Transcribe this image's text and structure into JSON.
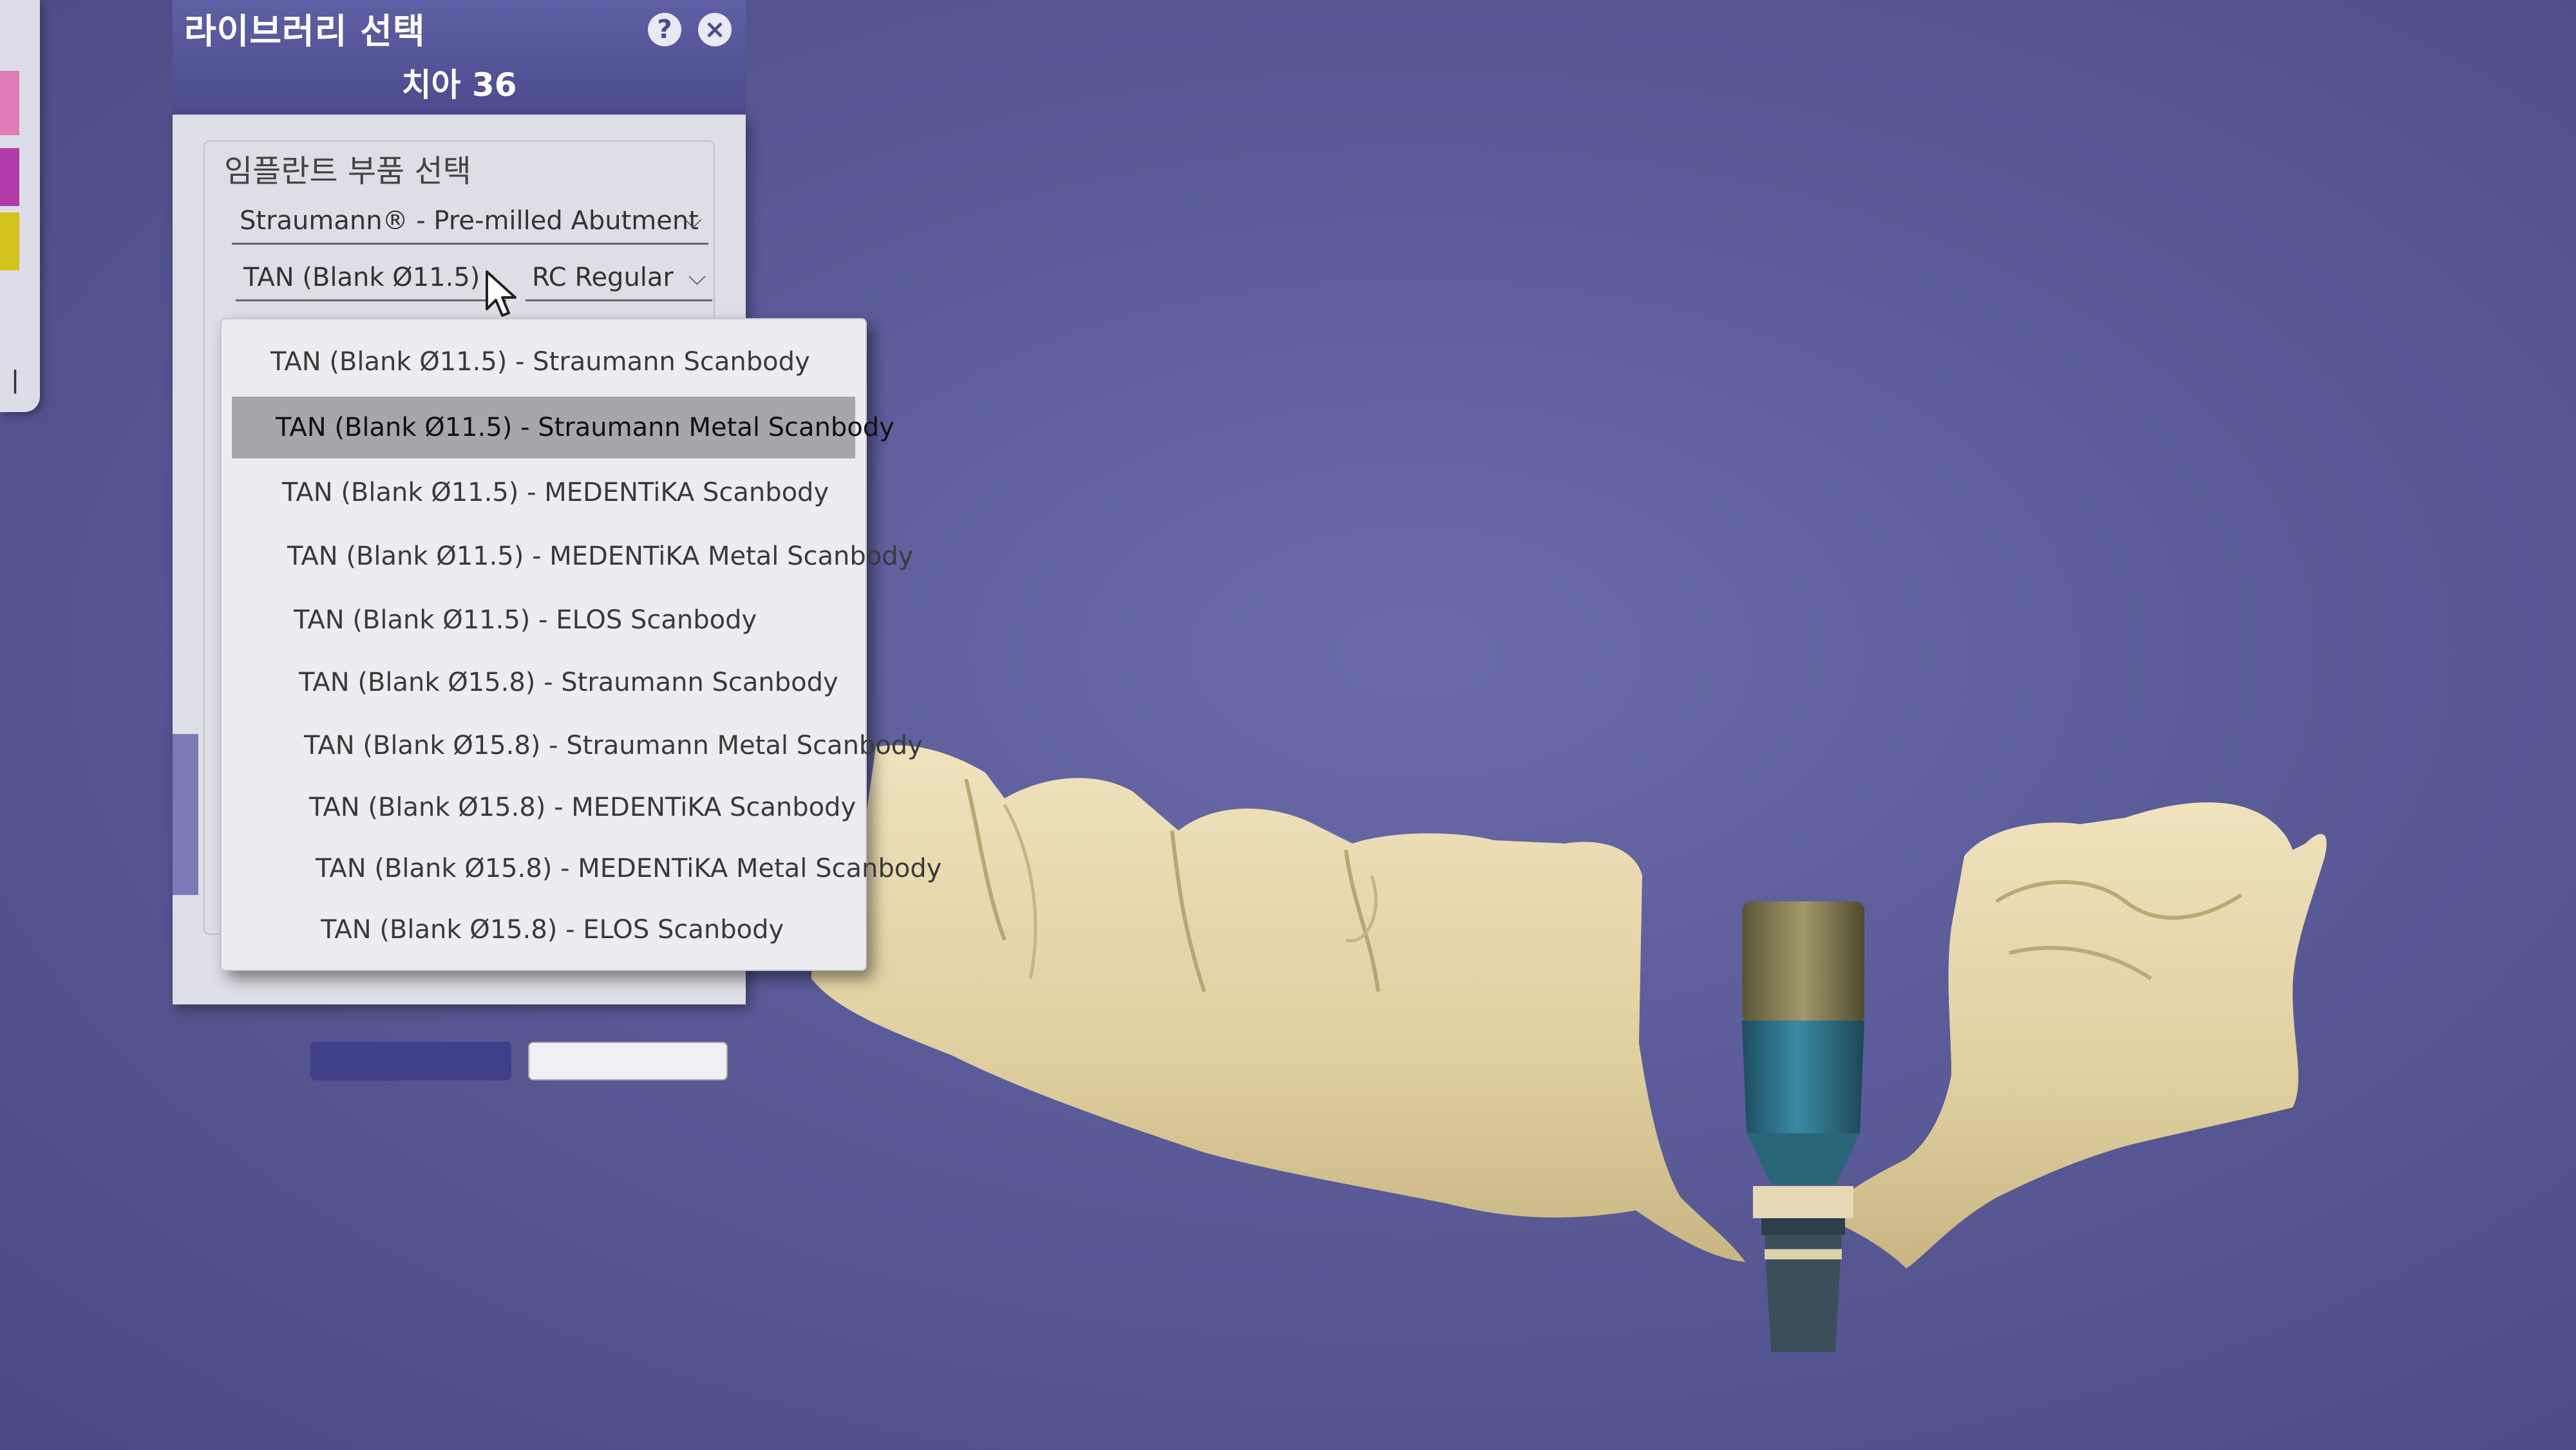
{
  "dialog": {
    "title": "라이브러리 선택",
    "subtitle": "치아 36",
    "help_icon": "question-icon",
    "close_icon": "close-icon",
    "section_title": "임플란트 부품 선택",
    "library_select": "Straumann® - Pre-milled Abutment",
    "part_select": "TAN (Blank Ø11.5) ·",
    "connection_select": "RC Regular"
  },
  "dropdown": {
    "selected_index": 1,
    "items": [
      "TAN (Blank Ø11.5) - Straumann Scanbody",
      "TAN (Blank Ø11.5) - Straumann Metal Scanbody",
      "TAN (Blank Ø11.5) - MEDENTiKA Scanbody",
      "TAN (Blank Ø11.5) - MEDENTiKA Metal Scanbody",
      "TAN (Blank Ø11.5) - ELOS Scanbody",
      "TAN (Blank Ø15.8) - Straumann Scanbody",
      "TAN (Blank Ø15.8) - Straumann Metal Scanbody",
      "TAN (Blank Ø15.8) - MEDENTiKA Scanbody",
      "TAN (Blank Ø15.8) - MEDENTiKA Metal Scanbody",
      "TAN (Blank Ø15.8) - ELOS Scanbody"
    ]
  },
  "left_strip": {
    "glyph": "ㅣ"
  },
  "colors": {
    "background": "#5b5c99",
    "header": "#4b4b8e",
    "model": "#e3d3a6",
    "implant_body": "#2f6f86"
  }
}
